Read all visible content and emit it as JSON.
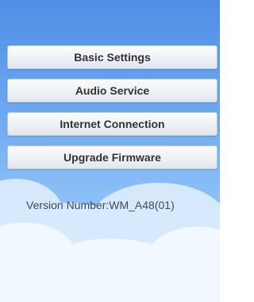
{
  "menu": {
    "items": [
      {
        "label": "Basic Settings"
      },
      {
        "label": "Audio Service"
      },
      {
        "label": "Internet Connection"
      },
      {
        "label": "Upgrade Firmware"
      }
    ]
  },
  "footer": {
    "version_label": "Version Number:WM_A48(01)"
  },
  "colors": {
    "sky_top": "#4f8ee6",
    "sky_bottom": "#a9d1fb",
    "button_text": "#333333"
  }
}
